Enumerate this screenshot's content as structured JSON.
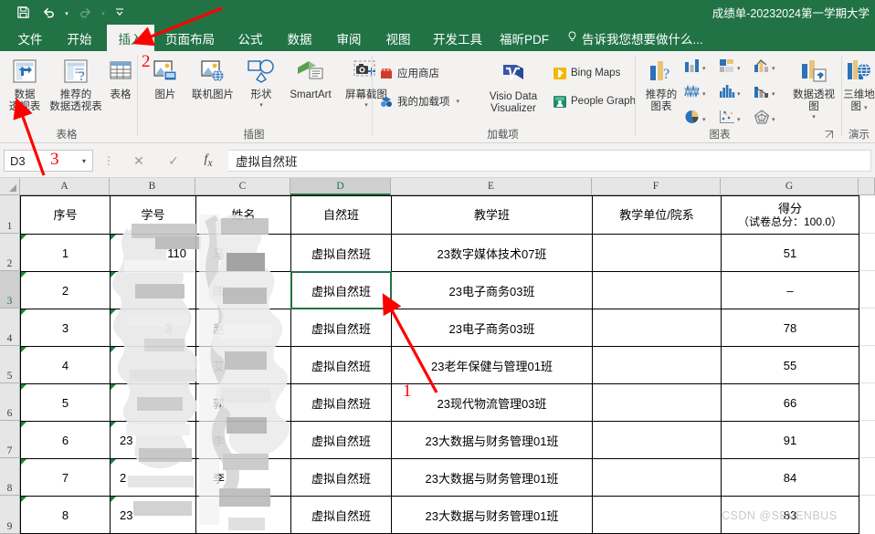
{
  "titlebar": {
    "document_title": "成绩单-20232024第一学期大学",
    "quick_access": [
      {
        "name": "save",
        "icon": "save-icon"
      },
      {
        "name": "undo",
        "icon": "undo-icon"
      },
      {
        "name": "redo",
        "icon": "redo-icon"
      },
      {
        "name": "customize",
        "icon": "customize-qat-icon"
      }
    ]
  },
  "ribbon": {
    "tabs": [
      {
        "label": "文件",
        "active": false
      },
      {
        "label": "开始",
        "active": false
      },
      {
        "label": "插入",
        "active": true
      },
      {
        "label": "页面布局",
        "active": false
      },
      {
        "label": "公式",
        "active": false
      },
      {
        "label": "数据",
        "active": false
      },
      {
        "label": "审阅",
        "active": false
      },
      {
        "label": "视图",
        "active": false
      },
      {
        "label": "开发工具",
        "active": false
      },
      {
        "label": "福昕PDF",
        "active": false
      }
    ],
    "tell_me": "告诉我您想要做什么...",
    "groups": [
      {
        "name": "tables",
        "label": "表格",
        "items": [
          {
            "label_line1": "数据",
            "label_line2": "透视表",
            "icon": "pivot-table-icon"
          },
          {
            "label_line1": "推荐的",
            "label_line2": "数据透视表",
            "icon": "recommended-pivot-table-icon"
          },
          {
            "label_line1": "表格",
            "label_line2": "",
            "icon": "table-icon"
          }
        ]
      },
      {
        "name": "illustrations",
        "label": "插图",
        "items": [
          {
            "label_line1": "图片",
            "label_line2": "",
            "icon": "picture-icon"
          },
          {
            "label_line1": "联机图片",
            "label_line2": "",
            "icon": "online-picture-icon"
          },
          {
            "label_line1": "形状",
            "label_line2": "",
            "icon": "shapes-icon"
          },
          {
            "label_line1": "SmartArt",
            "label_line2": "",
            "icon": "smartart-icon"
          },
          {
            "label_line1": "屏幕截图",
            "label_line2": "",
            "icon": "screenshot-icon"
          }
        ]
      },
      {
        "name": "addins",
        "label": "加载项",
        "items": [
          {
            "label": "应用商店",
            "icon": "store-icon"
          },
          {
            "label": "我的加载项",
            "icon": "my-addins-icon"
          },
          {
            "label": "Visio Data Visualizer",
            "icon": "visio-icon"
          },
          {
            "label": "Bing Maps",
            "icon": "bing-maps-icon"
          },
          {
            "label": "People Graph",
            "icon": "people-graph-icon"
          }
        ]
      },
      {
        "name": "charts",
        "label": "图表",
        "items": [
          {
            "label_line1": "推荐的",
            "label_line2": "图表",
            "icon": "recommended-charts-icon"
          },
          {
            "label_line1": "数据透视图",
            "label_line2": "",
            "icon": "pivot-chart-icon"
          }
        ],
        "chart_type_icons": [
          "column-chart-icon",
          "bar-chart-icon",
          "combo-chart-icon",
          "line-chart-icon",
          "histogram-chart-icon",
          "waterfall-chart-icon",
          "pie-chart-icon",
          "scatter-chart-icon",
          "radar-chart-icon"
        ]
      },
      {
        "name": "tours",
        "label": "演示",
        "items": [
          {
            "label_line1": "三维地",
            "label_line2": "图",
            "icon": "3d-map-icon"
          }
        ]
      }
    ]
  },
  "formula_bar": {
    "name_box_value": "D3",
    "cancel_icon": "cancel-icon",
    "confirm_icon": "confirm-icon",
    "function_icon": "fx-icon",
    "formula_value": "虚拟自然班"
  },
  "sheet": {
    "column_headers": [
      "A",
      "B",
      "C",
      "D",
      "E",
      "F",
      "G"
    ],
    "selected_column": "D",
    "row_headers": [
      "1",
      "2",
      "3",
      "4",
      "5",
      "6",
      "7",
      "8",
      "9"
    ],
    "selected_row": "3",
    "selected_cell": "D3",
    "header_row": {
      "A": "序号",
      "B": "学号",
      "C": "姓名",
      "D": "自然班",
      "E": "教学班",
      "F": "教学单位/院系",
      "G_line1": "得分",
      "G_line2": "（试卷总分：100.0）"
    },
    "rows": [
      {
        "row": "2",
        "A": "1",
        "B": "110",
        "C": "马",
        "D": "虚拟自然班",
        "E": "23数字媒体技术07班",
        "F": "",
        "G": "51"
      },
      {
        "row": "3",
        "A": "2",
        "B": "",
        "C": "陈",
        "D": "虚拟自然班",
        "E": "23电子商务03班",
        "F": "",
        "G": "–"
      },
      {
        "row": "4",
        "A": "3",
        "B": "3",
        "C": "赵",
        "D": "虚拟自然班",
        "E": "23电子商务03班",
        "F": "",
        "G": "78"
      },
      {
        "row": "5",
        "A": "4",
        "B": "",
        "C": "艾",
        "D": "虚拟自然班",
        "E": "23老年保健与管理01班",
        "F": "",
        "G": "55"
      },
      {
        "row": "6",
        "A": "5",
        "B": "",
        "C": "郭",
        "D": "虚拟自然班",
        "E": "23现代物流管理03班",
        "F": "",
        "G": "66"
      },
      {
        "row": "7",
        "A": "6",
        "B": "23",
        "C": "李",
        "D": "虚拟自然班",
        "E": "23大数据与财务管理01班",
        "F": "",
        "G": "91"
      },
      {
        "row": "8",
        "A": "7",
        "B": "2",
        "C": "李",
        "D": "虚拟自然班",
        "E": "23大数据与财务管理01班",
        "F": "",
        "G": "84"
      },
      {
        "row": "9",
        "A": "8",
        "B": "23",
        "C": "",
        "D": "虚拟自然班",
        "E": "23大数据与财务管理01班",
        "F": "",
        "G": "83"
      }
    ]
  },
  "annotations": {
    "markers": [
      {
        "label": "1",
        "target": "cell-d3-selection"
      },
      {
        "label": "2",
        "target": "insert-illustrations-group"
      },
      {
        "label": "3",
        "target": "pivot-table-button"
      }
    ],
    "color": "#ff0000"
  },
  "watermark": "CSDN @SEVENBUS",
  "colors": {
    "excel_green": "#217346",
    "ribbon_bg": "#f3f2f1",
    "annotation_red": "#ff0000"
  }
}
